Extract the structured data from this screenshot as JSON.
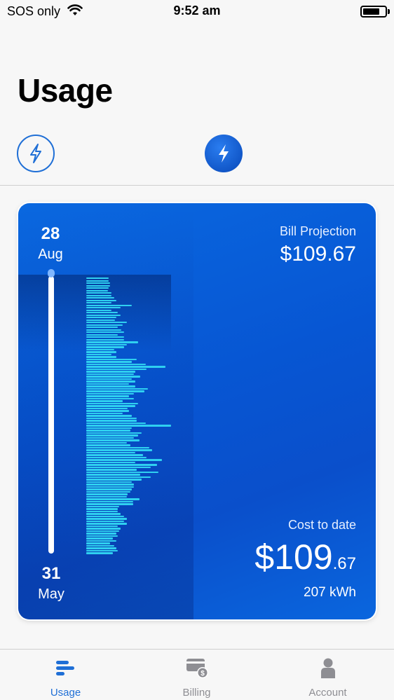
{
  "status_bar": {
    "carrier": "SOS only",
    "time": "9:52 am",
    "battery_level": 0.75
  },
  "header": {
    "title": "Usage"
  },
  "utility_types": [
    {
      "name": "electricity",
      "icon": "lightning-outline-icon",
      "selected": false
    },
    {
      "name": "electricity",
      "icon": "lightning-filled-icon",
      "selected": true
    }
  ],
  "card": {
    "start_date": {
      "day": "28",
      "month": "Aug"
    },
    "end_date": {
      "day": "31",
      "month": "May"
    },
    "bill_projection_label": "Bill Projection",
    "bill_projection_value": "$109.67",
    "cost_to_date_label": "Cost to date",
    "cost_to_date_whole": "$109",
    "cost_to_date_cents": ".67",
    "kwh_text": "207 kWh"
  },
  "daily_usage_relative": [
    0.18,
    0.18,
    0.19,
    0.19,
    0.18,
    0.17,
    0.2,
    0.2,
    0.22,
    0.24,
    0.2,
    0.36,
    0.27,
    0.2,
    0.25,
    0.27,
    0.24,
    0.23,
    0.32,
    0.29,
    0.25,
    0.28,
    0.3,
    0.25,
    0.3,
    0.3,
    0.41,
    0.32,
    0.3,
    0.22,
    0.24,
    0.2,
    0.24,
    0.4,
    0.36,
    0.47,
    0.63,
    0.48,
    0.39,
    0.38,
    0.43,
    0.36,
    0.39,
    0.34,
    0.39,
    0.49,
    0.46,
    0.38,
    0.34,
    0.38,
    0.29,
    0.41,
    0.39,
    0.33,
    0.34,
    0.29,
    0.36,
    0.4,
    0.4,
    0.47,
    0.67,
    0.36,
    0.35,
    0.44,
    0.41,
    0.38,
    0.42,
    0.32,
    0.35,
    0.5,
    0.52,
    0.39,
    0.45,
    0.48,
    0.6,
    0.39,
    0.56,
    0.51,
    0.4,
    0.57,
    0.43,
    0.51,
    0.44,
    0.36,
    0.38,
    0.38,
    0.36,
    0.35,
    0.33,
    0.32,
    0.42,
    0.37,
    0.37,
    0.26,
    0.25,
    0.25,
    0.27,
    0.3,
    0.32,
    0.3,
    0.32,
    0.25,
    0.27,
    0.26,
    0.24,
    0.25,
    0.21,
    0.24,
    0.19,
    0.22,
    0.24,
    0.25,
    0.21
  ],
  "tabs": [
    {
      "label": "Usage",
      "icon": "usage-bars-icon",
      "active": true
    },
    {
      "label": "Billing",
      "icon": "bill-dollar-icon",
      "active": false
    },
    {
      "label": "Account",
      "icon": "person-icon",
      "active": false
    }
  ],
  "colors": {
    "accent": "#1f6fd6",
    "card": "#0756d3",
    "bars": "#2fd0f0",
    "inactive_tab": "#8e8e93"
  }
}
